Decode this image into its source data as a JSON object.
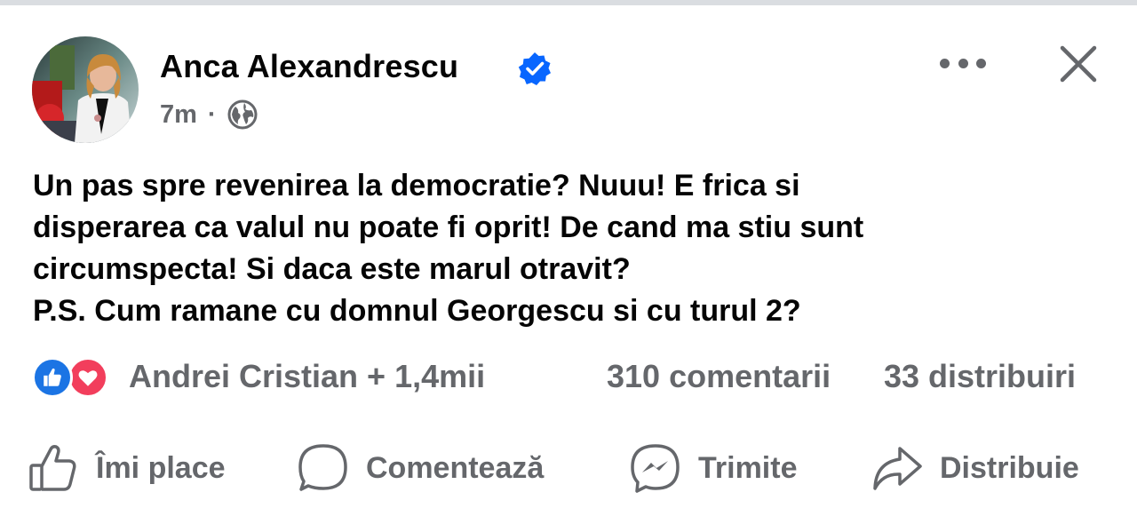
{
  "post": {
    "author": "Anca Alexandrescu",
    "verified_icon": "verified-badge-icon",
    "time": "7m",
    "separator": "·",
    "audience_icon": "globe-icon",
    "text_lines": [
      "Un pas spre revenirea la democratie? Nuuu! E frica si",
      "disperarea ca valul nu poate fi oprit! De cand ma stiu sunt",
      "circumspecta! Si daca este marul otravit?",
      "P.S. Cum ramane cu domnul Georgescu si cu turul 2?"
    ]
  },
  "stats": {
    "reactions_label": "Andrei Cristian + 1,4mii",
    "comments": "310 comentarii",
    "shares": "33 distribuiri"
  },
  "actions": {
    "like": "Îmi place",
    "comment": "Comentează",
    "send": "Trimite",
    "share": "Distribuie"
  },
  "colors": {
    "text": "#050505",
    "secondary": "#65676b",
    "like_blue": "#1b74e4",
    "love_red": "#f23e5c",
    "verified_blue": "#0866ff"
  }
}
